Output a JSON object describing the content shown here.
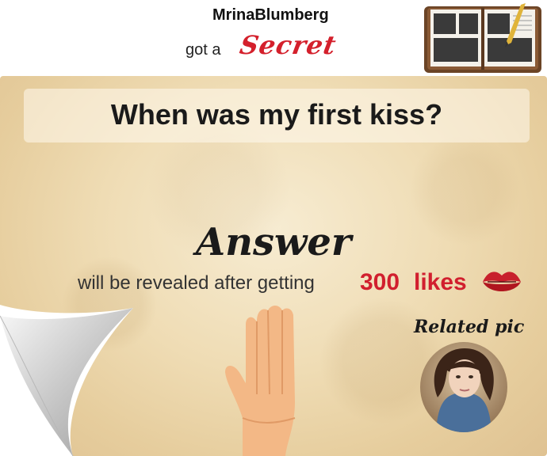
{
  "header": {
    "username": "MrinaBlumberg",
    "got_text": "got a",
    "secret_text": "Secret"
  },
  "card": {
    "question": "When was my first kiss?",
    "answer_heading": "Answer",
    "reveal_text": "will be revealed after getting",
    "likes_count": "300",
    "likes_label": "likes",
    "related_label": "Related pic"
  },
  "colors": {
    "accent_red": "#d11f2e",
    "paper": "#efdcb4",
    "text_dark": "#1a1a1a"
  },
  "icons": [
    "notebook-icon",
    "lips-icon",
    "hand-icon",
    "profile-photo",
    "page-curl"
  ]
}
